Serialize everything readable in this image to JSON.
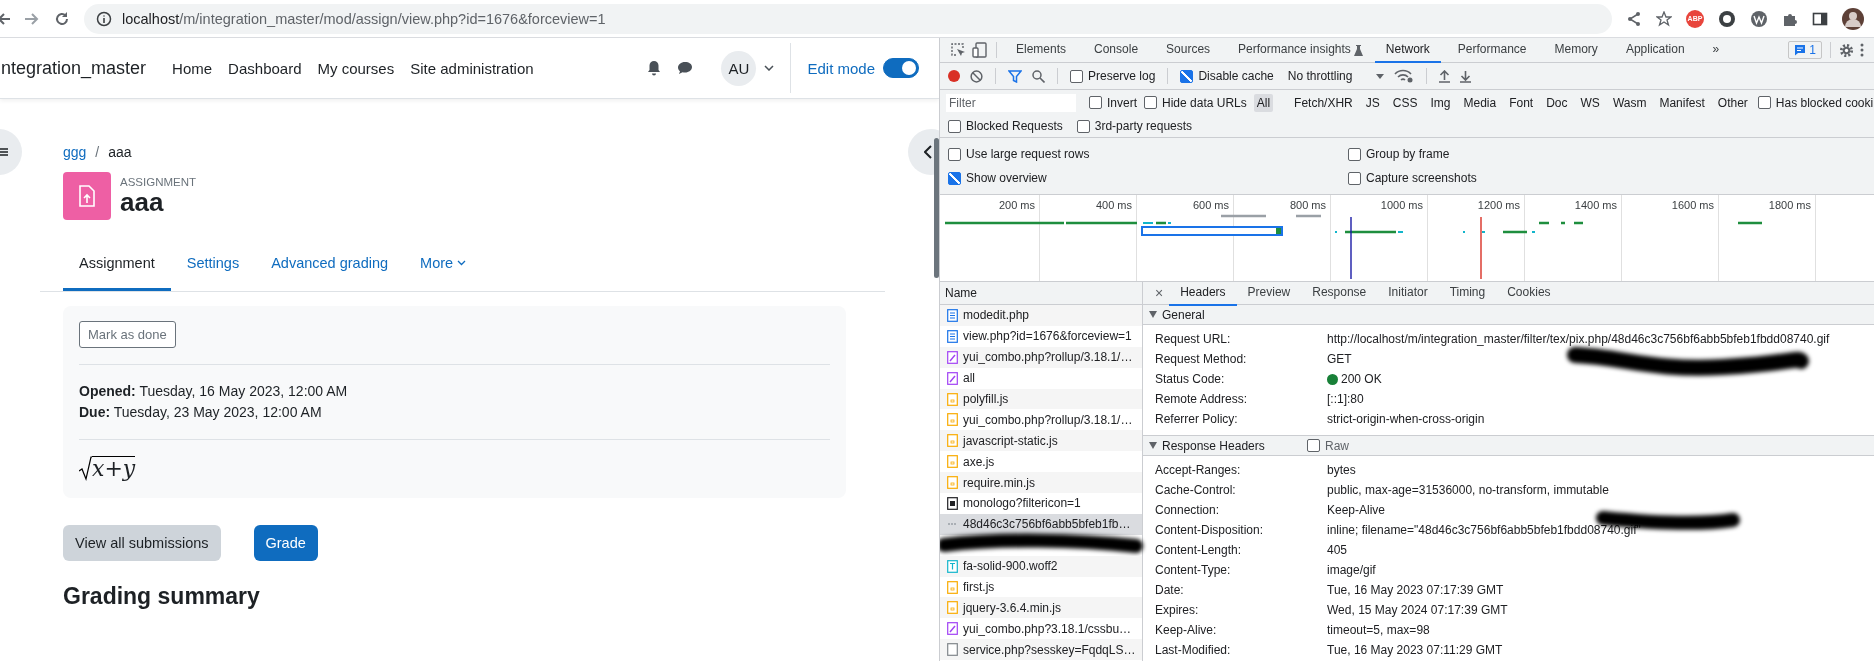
{
  "browser": {
    "url_host": "localhost",
    "url_path": "/m/integration_master/mod/assign/view.php?id=1676&forceview=1",
    "extension_label": "ABP"
  },
  "site": {
    "name": "ntegration_master",
    "nav": [
      "Home",
      "Dashboard",
      "My courses",
      "Site administration"
    ],
    "avatar": "AU",
    "edit_mode": {
      "label": "Edit mode",
      "on": true
    }
  },
  "breadcrumb": {
    "items": [
      {
        "label": "ggg",
        "link": true
      },
      {
        "label": "aaa",
        "link": false
      }
    ],
    "separator": "/"
  },
  "activity": {
    "type_label": "ASSIGNMENT",
    "title": "aaa"
  },
  "tabs": [
    {
      "label": "Assignment",
      "selected": true,
      "kind": "tab"
    },
    {
      "label": "Settings",
      "selected": false,
      "kind": "tab"
    },
    {
      "label": "Advanced grading",
      "selected": false,
      "kind": "tab"
    },
    {
      "label": "More",
      "selected": false,
      "kind": "dropdown"
    }
  ],
  "card": {
    "button": "Mark as done",
    "dates": [
      {
        "label": "Opened:",
        "value": "Tuesday, 16 May 2023, 12:00 AM"
      },
      {
        "label": "Due:",
        "value": "Tuesday, 23 May 2023, 12:00 AM"
      }
    ],
    "formula": "x+y"
  },
  "buttons": [
    {
      "label": "View all submissions",
      "kind": "secondary"
    },
    {
      "label": "Grade",
      "kind": "primary"
    }
  ],
  "heading": "Grading summary",
  "devtools": {
    "tabs": [
      {
        "label": "Elements",
        "selected": false
      },
      {
        "label": "Console",
        "selected": false
      },
      {
        "label": "Sources",
        "selected": false
      },
      {
        "label": "Performance insights",
        "selected": false
      },
      {
        "label": "Network",
        "selected": true
      },
      {
        "label": "Performance",
        "selected": false
      },
      {
        "label": "Memory",
        "selected": false
      },
      {
        "label": "Application",
        "selected": false
      }
    ],
    "more_tabs": "»",
    "issues_count": "1",
    "toolbar": {
      "recording": true,
      "preserve_log": {
        "label": "Preserve log",
        "checked": false
      },
      "disable_cache": {
        "label": "Disable cache",
        "checked": true
      },
      "throttling": "No throttling"
    },
    "filter": {
      "placeholder": "Filter",
      "toggles": [
        {
          "label": "Invert",
          "checked": false
        },
        {
          "label": "Hide data URLs",
          "checked": false
        }
      ],
      "types": [
        {
          "label": "All",
          "selected": true
        },
        {
          "label": "Fetch/XHR",
          "selected": false
        },
        {
          "label": "JS",
          "selected": false
        },
        {
          "label": "CSS",
          "selected": false
        },
        {
          "label": "Img",
          "selected": false
        },
        {
          "label": "Media",
          "selected": false
        },
        {
          "label": "Font",
          "selected": false
        },
        {
          "label": "Doc",
          "selected": false
        },
        {
          "label": "WS",
          "selected": false
        },
        {
          "label": "Wasm",
          "selected": false
        },
        {
          "label": "Manifest",
          "selected": false
        },
        {
          "label": "Other",
          "selected": false
        }
      ],
      "blocked_cookies": {
        "label": "Has blocked cooki",
        "checked": false
      },
      "extra": [
        {
          "label": "Blocked Requests",
          "checked": false
        },
        {
          "label": "3rd-party requests",
          "checked": false
        }
      ]
    },
    "settings": [
      {
        "label": "Use large request rows",
        "checked": false
      },
      {
        "label": "Group by frame",
        "checked": false
      },
      {
        "label": "Show overview",
        "checked": true
      },
      {
        "label": "Capture screenshots",
        "checked": false
      }
    ],
    "timeline_ticks": [
      "200 ms",
      "400 ms",
      "600 ms",
      "800 ms",
      "1000 ms",
      "1200 ms",
      "1400 ms",
      "1600 ms",
      "1800 ms"
    ],
    "name_header": "Name",
    "requests": [
      {
        "name": "modedit.php",
        "kind": "doc",
        "selected": false
      },
      {
        "name": "view.php?id=1676&forceview=1",
        "kind": "doc",
        "selected": false
      },
      {
        "name": "yui_combo.php?rollup/3.18.1/…",
        "kind": "style",
        "selected": false
      },
      {
        "name": "all",
        "kind": "style",
        "selected": false
      },
      {
        "name": "polyfill.js",
        "kind": "script",
        "selected": false
      },
      {
        "name": "yui_combo.php?rollup/3.18.1/…",
        "kind": "script",
        "selected": false
      },
      {
        "name": "javascript-static.js",
        "kind": "script",
        "selected": false
      },
      {
        "name": "axe.js",
        "kind": "script",
        "selected": false
      },
      {
        "name": "require.min.js",
        "kind": "script",
        "selected": false
      },
      {
        "name": "monologo?filtericon=1",
        "kind": "image",
        "selected": false
      },
      {
        "name": "48d46c3c756bf6abb5bfeb1fb…",
        "kind": "gif",
        "selected": true
      },
      {
        "kind": "redacted",
        "selected": false
      },
      {
        "name": "fa-solid-900.woff2",
        "kind": "font",
        "selected": false
      },
      {
        "name": "first.js",
        "kind": "script",
        "selected": false
      },
      {
        "name": "jquery-3.6.4.min.js",
        "kind": "script",
        "selected": false
      },
      {
        "name": "yui_combo.php?3.18.1/cssbu…",
        "kind": "style",
        "selected": false
      },
      {
        "name": "service.php?sesskey=FqdqLS…",
        "kind": "other",
        "selected": false
      }
    ],
    "detail_close": "×",
    "detail_tabs": [
      {
        "label": "Headers",
        "selected": true
      },
      {
        "label": "Preview",
        "selected": false
      },
      {
        "label": "Response",
        "selected": false
      },
      {
        "label": "Initiator",
        "selected": false
      },
      {
        "label": "Timing",
        "selected": false
      },
      {
        "label": "Cookies",
        "selected": false
      }
    ],
    "general": {
      "title": "General",
      "expanded": true,
      "rows": [
        {
          "label": "Request URL:",
          "value": "http://localhost/m/integration_master/filter/tex/pix.php/48d46c3c756bf6abb5bfeb1fbdd08740.gif",
          "kind": "text"
        },
        {
          "label": "Request Method:",
          "value": "GET",
          "kind": "text"
        },
        {
          "label": "Status Code:",
          "value": "200 OK",
          "kind": "status",
          "color": "#188038"
        },
        {
          "label": "Remote Address:",
          "value": "[::1]:80",
          "kind": "text"
        },
        {
          "label": "Referrer Policy:",
          "value": "strict-origin-when-cross-origin",
          "kind": "text"
        }
      ]
    },
    "response_headers": {
      "title": "Response Headers",
      "expanded": true,
      "raw": {
        "label": "Raw",
        "checked": false
      },
      "rows": [
        {
          "label": "Accept-Ranges:",
          "value": "bytes"
        },
        {
          "label": "Cache-Control:",
          "value": "public, max-age=31536000, no-transform, immutable"
        },
        {
          "label": "Connection:",
          "value": "Keep-Alive"
        },
        {
          "label": "Content-Disposition:",
          "value": "inline; filename=\"48d46c3c756bf6abb5bfeb1fbdd08740.gif\""
        },
        {
          "label": "Content-Length:",
          "value": "405"
        },
        {
          "label": "Content-Type:",
          "value": "image/gif"
        },
        {
          "label": "Date:",
          "value": "Tue, 16 May 2023 07:17:39 GMT"
        },
        {
          "label": "Expires:",
          "value": "Wed, 15 May 2024 07:17:39 GMT"
        },
        {
          "label": "Keep-Alive:",
          "value": "timeout=5, max=98"
        },
        {
          "label": "Last-Modified:",
          "value": "Tue, 16 May 2023 07:11:29 GMT"
        }
      ]
    }
  }
}
